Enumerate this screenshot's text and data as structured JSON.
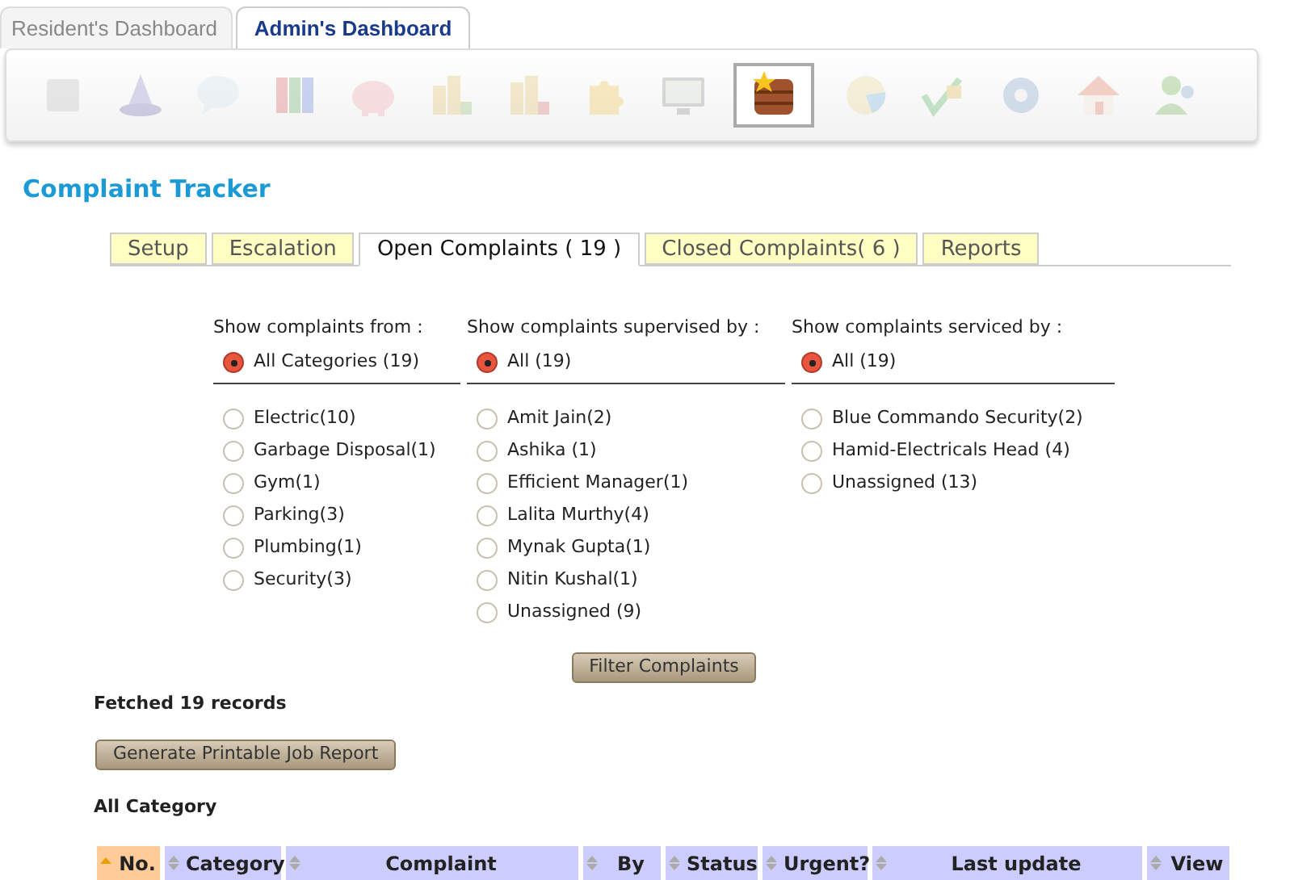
{
  "dashboard_tabs": [
    {
      "label": "Resident's Dashboard",
      "selected": false
    },
    {
      "label": "Admin's Dashboard",
      "selected": true
    }
  ],
  "toolbar": [
    {
      "selected": false
    },
    {
      "selected": false
    },
    {
      "selected": false
    },
    {
      "selected": false
    },
    {
      "selected": false
    },
    {
      "selected": false
    },
    {
      "selected": false
    },
    {
      "selected": false
    },
    {
      "selected": false
    },
    {
      "selected": true
    },
    {
      "selected": false
    },
    {
      "selected": false
    },
    {
      "selected": false
    },
    {
      "selected": false
    },
    {
      "selected": false
    }
  ],
  "title": "Complaint Tracker",
  "tabs": [
    {
      "label": "Setup",
      "selected": false
    },
    {
      "label": "Escalation",
      "selected": false
    },
    {
      "label": "Open Complaints ( 19 )",
      "selected": true
    },
    {
      "label": "Closed Complaints( 6 )",
      "selected": false
    },
    {
      "label": "Reports",
      "selected": false
    }
  ],
  "filters": [
    {
      "heading": "Show complaints from :",
      "all": {
        "label": "All Categories (19)",
        "selected": true
      },
      "options": [
        {
          "label": "Electric(10)",
          "selected": false
        },
        {
          "label": "Garbage Disposal(1)",
          "selected": false
        },
        {
          "label": "Gym(1)",
          "selected": false
        },
        {
          "label": "Parking(3)",
          "selected": false
        },
        {
          "label": "Plumbing(1)",
          "selected": false
        },
        {
          "label": "Security(3)",
          "selected": false
        }
      ]
    },
    {
      "heading": "Show complaints supervised by :",
      "all": {
        "label": "All (19)",
        "selected": true
      },
      "options": [
        {
          "label": "Amit Jain(2)",
          "selected": false
        },
        {
          "label": "Ashika (1)",
          "selected": false
        },
        {
          "label": "Efficient Manager(1)",
          "selected": false
        },
        {
          "label": "Lalita Murthy(4)",
          "selected": false
        },
        {
          "label": "Mynak Gupta(1)",
          "selected": false
        },
        {
          "label": "Nitin Kushal(1)",
          "selected": false
        },
        {
          "label": "Unassigned (9)",
          "selected": false
        }
      ]
    },
    {
      "heading": "Show complaints serviced by :",
      "all": {
        "label": "All (19)",
        "selected": true
      },
      "options": [
        {
          "label": "Blue Commando Security(2)",
          "selected": false
        },
        {
          "label": "Hamid-Electricals Head (4)",
          "selected": false
        },
        {
          "label": "Unassigned (13)",
          "selected": false
        }
      ]
    }
  ],
  "filter_button": "Filter Complaints",
  "fetched": "Fetched 19 records",
  "report_button": "Generate Printable Job Report",
  "category_heading": "All Category",
  "table": {
    "columns": [
      {
        "label": "No.",
        "sorted": true
      },
      {
        "label": "Category",
        "sorted": false
      },
      {
        "label": "Complaint",
        "sorted": false
      },
      {
        "label": "By",
        "sorted": false
      },
      {
        "label": "Status",
        "sorted": false
      },
      {
        "label": "Urgent?",
        "sorted": false
      },
      {
        "label": "Last update",
        "sorted": false
      },
      {
        "label": "View",
        "sorted": false
      }
    ]
  }
}
